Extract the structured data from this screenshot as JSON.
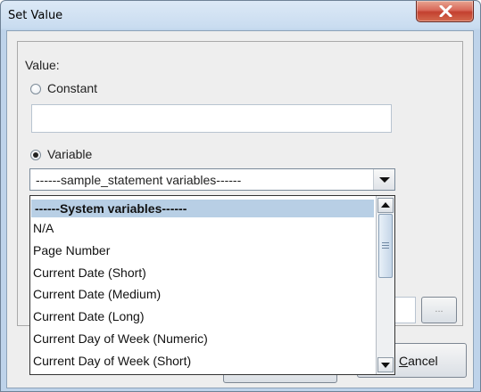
{
  "window": {
    "title": "Set Value",
    "close_icon": "close-x-icon"
  },
  "form": {
    "value_label": "Value:",
    "constant_label": "Constant",
    "constant_checked": false,
    "constant_value": "",
    "variable_label": "Variable",
    "variable_checked": true
  },
  "combo": {
    "selected": "------sample_statement variables------",
    "arrow_icon": "chevron-down-icon"
  },
  "dropdown": {
    "items": [
      "------System variables------",
      "N/A",
      "Page Number",
      "Current Date (Short)",
      "Current Date (Medium)",
      "Current Date (Long)",
      "Current Day of Week (Numeric)",
      "Current Day of Week (Short)"
    ],
    "highlighted_index": 0
  },
  "buttons": {
    "ellipsis_label": "...",
    "cancel_underlined": "C",
    "cancel_rest": "ancel"
  },
  "colors": {
    "selection": "#b8cfe5",
    "close_button": "#c3402f",
    "title_bar": "#c9dcf0"
  }
}
